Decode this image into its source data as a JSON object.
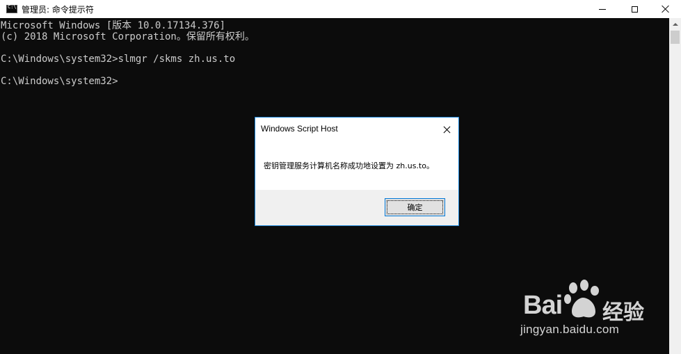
{
  "window": {
    "title": "管理员: 命令提示符"
  },
  "console": {
    "lines": [
      "Microsoft Windows [版本 10.0.17134.376]",
      "(c) 2018 Microsoft Corporation。保留所有权利。",
      "C:\\Windows\\system32>slmgr /skms zh.us.to",
      "C:\\Windows\\system32>"
    ]
  },
  "dialog": {
    "title": "Windows Script Host",
    "message": "密钥管理服务计算机名称成功地设置为 zh.us.to。",
    "ok_label": "确定"
  },
  "watermark": {
    "brand_latin": "Bai",
    "brand_cn": "经验",
    "url": "jingyan.baidu.com"
  },
  "colors": {
    "console_bg": "#0c0c0c",
    "console_text": "#cccccc",
    "dialog_border": "#1883d7",
    "button_focus": "#0078d7"
  }
}
